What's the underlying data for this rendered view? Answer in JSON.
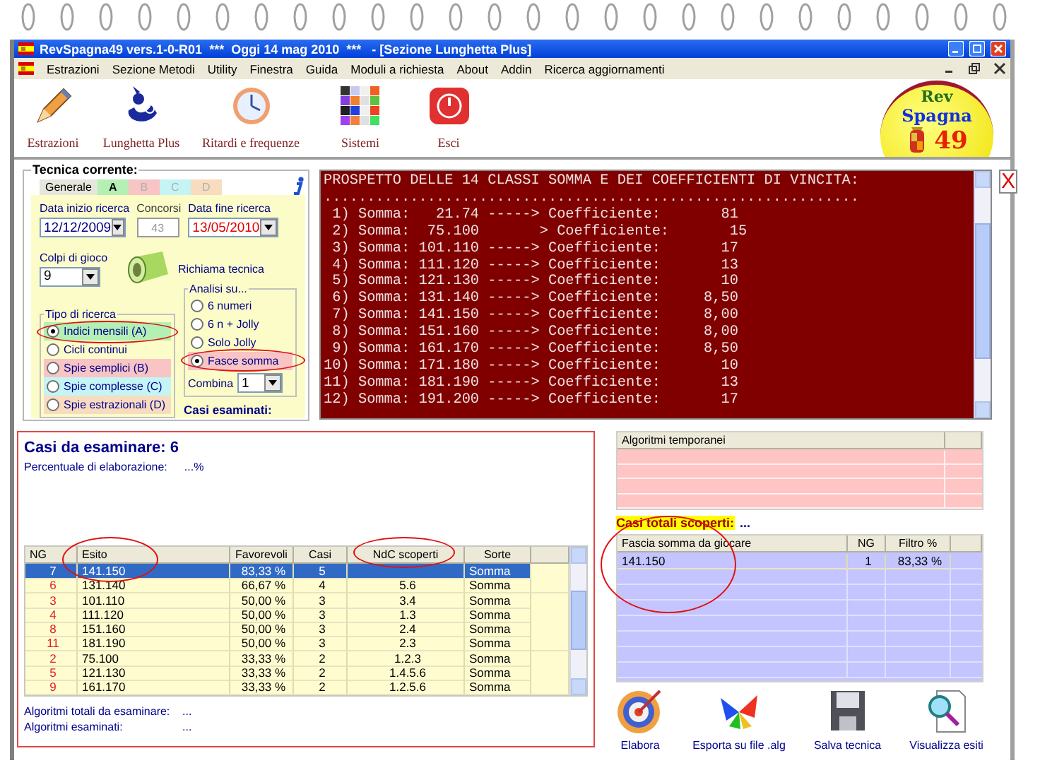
{
  "window": {
    "title": "RevSpagna49 vers.1-0-R01  ***  Oggi 14 mag 2010  ***   - [Sezione Lunghetta Plus]"
  },
  "menu": [
    "Estrazioni",
    "Sezione Metodi",
    "Utility",
    "Finestra",
    "Guida",
    "Moduli a richiesta",
    "About",
    "Addin",
    "Ricerca aggiornamenti"
  ],
  "toolbar": [
    {
      "kind": "pencil",
      "label": "Estrazioni"
    },
    {
      "kind": "figure",
      "label": "Lunghetta Plus"
    },
    {
      "kind": "clock",
      "label": "Ritardi e frequenze"
    },
    {
      "kind": "grid",
      "label": "Sistemi"
    },
    {
      "kind": "power",
      "label": "Esci"
    }
  ],
  "logo": {
    "top": "Rev",
    "middle": "Spagna",
    "number": "49"
  },
  "technique": {
    "title": "Tecnica corrente:",
    "tabs": [
      {
        "label": "Generale",
        "kind": "label",
        "color": "#e6e6dc"
      },
      {
        "label": "A",
        "selected": true,
        "color": "#b4f0b4"
      },
      {
        "label": "B",
        "selected": false,
        "color": "#f8c4c4"
      },
      {
        "label": "C",
        "selected": false,
        "color": "#c4f4f4"
      },
      {
        "label": "D",
        "selected": false,
        "color": "#f8dcc0"
      }
    ],
    "start_label": "Data inizio ricerca",
    "start_value": "12/12/2009",
    "draws_label": "Concorsi",
    "draws_value": "43",
    "end_label": "Data fine ricerca",
    "end_value": "13/05/2010",
    "shots_label": "Colpi di gioco",
    "shots_value": "9",
    "recall_label": "Richiama tecnica",
    "search_title": "Tipo di ricerca",
    "search_types": [
      {
        "label": "Indici mensili (A)",
        "selected": true,
        "color": "#b4f0b4"
      },
      {
        "label": "Cicli continui",
        "selected": false
      },
      {
        "label": "Spie semplici (B)",
        "selected": false,
        "color": "#f8c4c4"
      },
      {
        "label": "Spie complesse (C)",
        "selected": false,
        "color": "#c4f4f4"
      },
      {
        "label": "Spie estrazionali (D)",
        "selected": false,
        "color": "#f8dcc0"
      }
    ],
    "analysis_title": "Analisi su...",
    "analysis": [
      {
        "label": "6 numeri",
        "selected": false
      },
      {
        "label": "6 n + Jolly",
        "selected": false
      },
      {
        "label": "Solo Jolly",
        "selected": false
      },
      {
        "label": "Fasce somma",
        "selected": true,
        "color": "#f8c4c4"
      }
    ],
    "combine_label": "Combina",
    "combine_value": "1",
    "examined_label": "Casi esaminati:"
  },
  "console": {
    "header": "PROSPETTO DELLE 14 CLASSI SOMMA E DEI COEFFICIENTI DI VINCITA:",
    "separator": "..............................................................",
    "lines": [
      " 1) Somma:   21.74 -----> Coefficiente:       81",
      " 2) Somma:  75.100       > Coefficiente:       15",
      " 3) Somma: 101.110 -----> Coefficiente:       17",
      " 4) Somma: 111.120 -----> Coefficiente:       13",
      " 5) Somma: 121.130 -----> Coefficiente:       10",
      " 6) Somma: 131.140 -----> Coefficiente:     8,50",
      " 7) Somma: 141.150 -----> Coefficiente:     8,00",
      " 8) Somma: 151.160 -----> Coefficiente:     8,00",
      " 9) Somma: 161.170 -----> Coefficiente:     8,50",
      "10) Somma: 171.180 -----> Coefficiente:       10",
      "11) Somma: 181.190 -----> Coefficiente:       13",
      "12) Somma: 191.200 -----> Coefficiente:       17"
    ],
    "close": "X"
  },
  "cases": {
    "title": "Casi da esaminare: 6",
    "progress_label": "Percentuale di elaborazione:",
    "progress_value": "...%",
    "columns": [
      "NG",
      "Esito",
      "Favorevoli",
      "Casi",
      "NdC scoperti",
      "Sorte"
    ],
    "rows": [
      {
        "ng": "7",
        "esito": "141.150",
        "fav": "83,33 %",
        "casi": "5",
        "sorte": "Somma",
        "selected": true
      },
      {
        "ng": "6",
        "esito": "131.140",
        "fav": "66,67 %",
        "casi": "4",
        "ndc": "5.6",
        "sorte": "Somma",
        "selected": false
      },
      {
        "ng": "3",
        "esito": "101.110",
        "fav": "50,00 %",
        "casi": "3",
        "ndc": "3.4",
        "sorte": "Somma",
        "selected": false
      },
      {
        "ng": "4",
        "esito": "111.120",
        "fav": "50,00 %",
        "casi": "3",
        "ndc": "1.3",
        "sorte": "Somma",
        "selected": false
      },
      {
        "ng": "8",
        "esito": "151.160",
        "fav": "50,00 %",
        "casi": "3",
        "ndc": "2.4",
        "sorte": "Somma",
        "selected": false
      },
      {
        "ng": "11",
        "esito": "181.190",
        "fav": "50,00 %",
        "casi": "3",
        "ndc": "2.3",
        "sorte": "Somma",
        "selected": false
      },
      {
        "ng": "2",
        "esito": "75.100",
        "fav": "33,33 %",
        "casi": "2",
        "ndc": "1.2.3",
        "sorte": "Somma",
        "selected": false
      },
      {
        "ng": "5",
        "esito": "121.130",
        "fav": "33,33 %",
        "casi": "2",
        "ndc": "1.4.5.6",
        "sorte": "Somma",
        "selected": false
      },
      {
        "ng": "9",
        "esito": "161.170",
        "fav": "33,33 %",
        "casi": "2",
        "ndc": "1.2.5.6",
        "sorte": "Somma",
        "selected": false
      }
    ],
    "total_label": "Algoritmi totali da esaminare:",
    "total_value": "...",
    "done_label": "Algoritmi esaminati:",
    "done_value": "..."
  },
  "temp": {
    "column": "Algoritmi temporanei"
  },
  "found": {
    "label": "Casi totali scoperti:",
    "value": "...",
    "columns": [
      "Fascia somma da giocare",
      "NG",
      "Filtro %"
    ],
    "rows": [
      {
        "fascia": "141.150",
        "ng": "1",
        "filtro": "83,33 %"
      }
    ]
  },
  "actions": [
    {
      "kind": "target",
      "label": "Elabora"
    },
    {
      "kind": "butterfly",
      "label": "Esporta su file .alg"
    },
    {
      "kind": "floppy",
      "label": "Salva tecnica"
    },
    {
      "kind": "magnifier",
      "label": "Visualizza esiti"
    }
  ]
}
